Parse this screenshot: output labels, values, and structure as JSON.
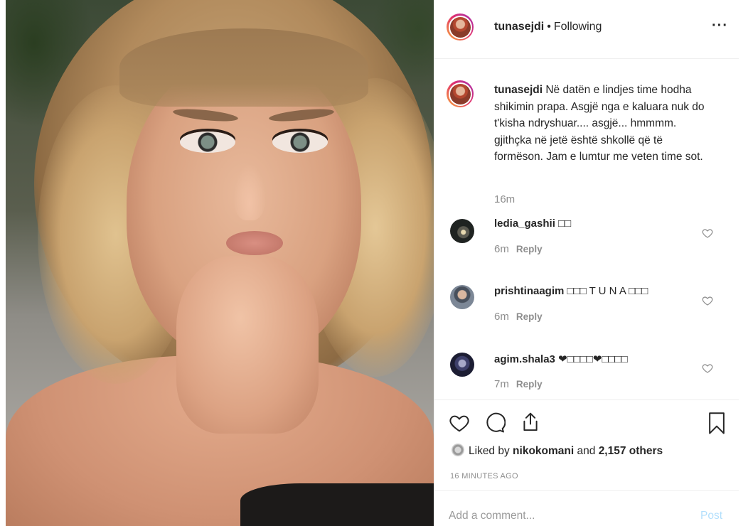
{
  "post": {
    "username": "tunasejdi",
    "separator": "•",
    "follow_status": "Following",
    "more_label": "···"
  },
  "caption": {
    "username": "tunasejdi",
    "text": "Në datën e lindjes time hodha shikimin prapa. Asgjë nga e kaluara nuk do t'kisha ndryshuar.... asgjë... hmmmm. gjithçka në jetë është shkollë që të formëson. Jam e lumtur me veten time sot.",
    "time": "16m"
  },
  "comments": [
    {
      "username": "ledia_gashii",
      "text": "□□",
      "time": "6m",
      "reply_label": "Reply"
    },
    {
      "username": "prishtinaagim",
      "text": "□□□ T U N A □□□",
      "time": "6m",
      "reply_label": "Reply"
    },
    {
      "username": "agim.shala3",
      "text": "❤□□□□❤□□□□",
      "time": "7m",
      "reply_label": "Reply"
    }
  ],
  "likes": {
    "prefix": "Liked by",
    "user": "nikokomani",
    "middle": "and",
    "count": "2,157 others"
  },
  "timestamp": "16 MINUTES AGO",
  "comment_box": {
    "placeholder": "Add a comment...",
    "post_label": "Post"
  },
  "icons": {
    "like": "heart-icon",
    "comment": "comment-icon",
    "share": "share-icon",
    "save": "bookmark-icon",
    "comment_like": "heart-icon"
  },
  "colors": {
    "text": "#262626",
    "muted": "#8e8e8e",
    "post_disabled": "#b2dffc",
    "separator": "#efefef"
  }
}
